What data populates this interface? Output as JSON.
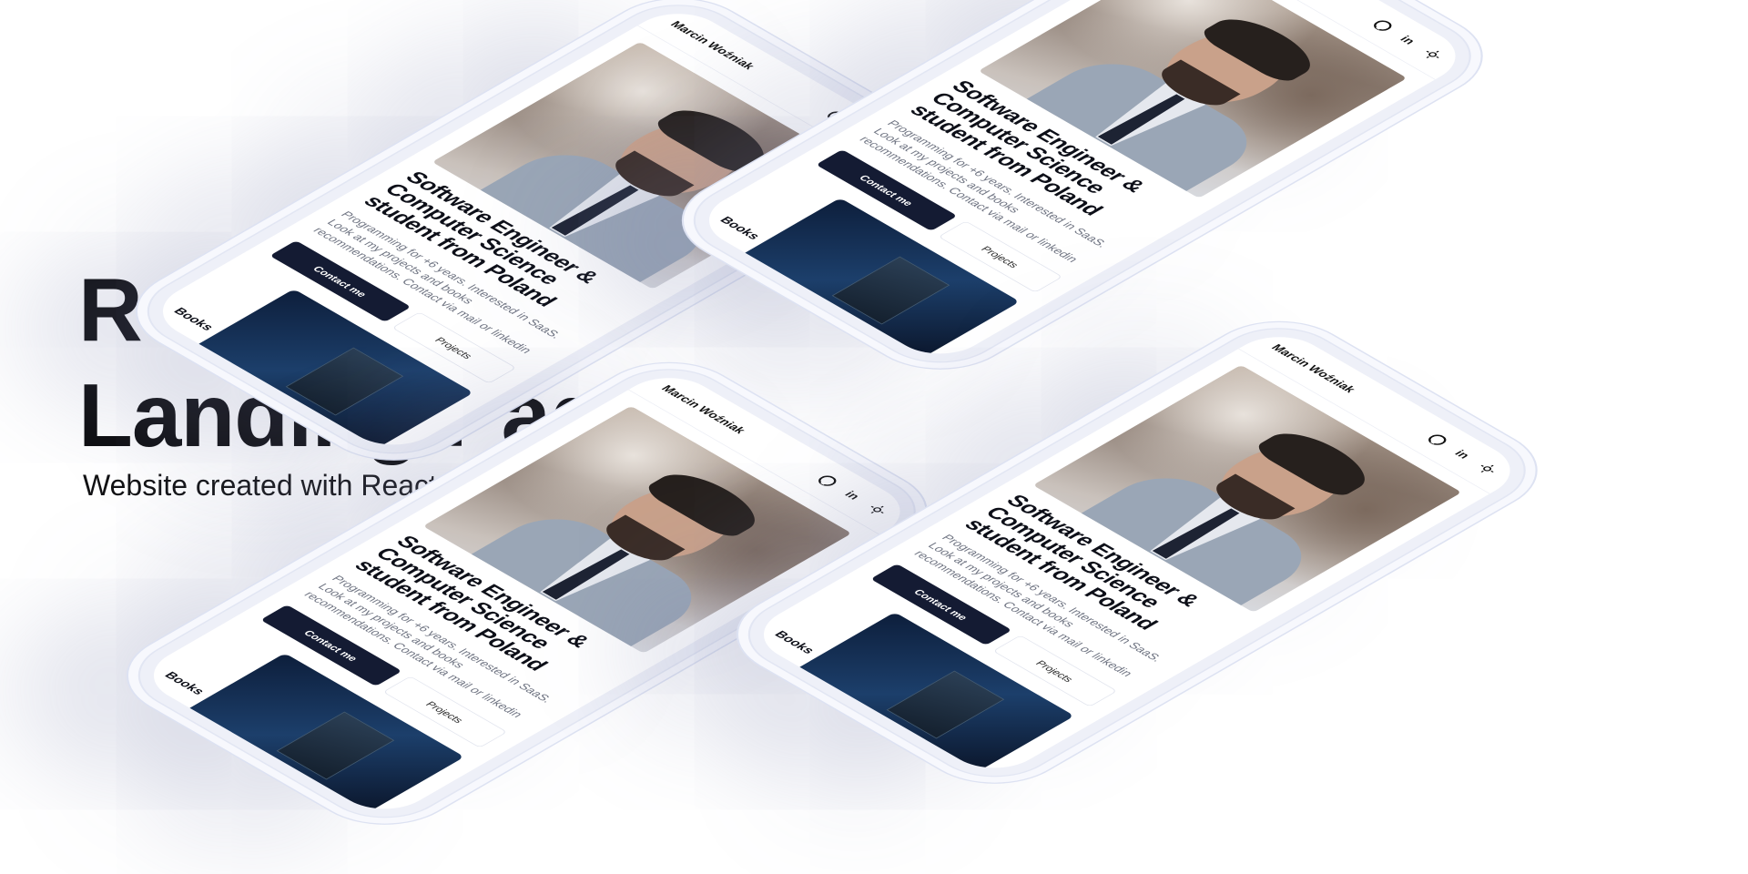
{
  "hero": {
    "title_line1": "React",
    "title_line2": "Landing Page",
    "subtitle": "Website created with React.js"
  },
  "mockup": {
    "brand": "Marcin Woźniak",
    "nav_icons": [
      "github-icon",
      "linkedin-icon",
      "sun-icon"
    ],
    "linkedin_glyph": "in",
    "headline_line1": "Software Engineer &",
    "headline_line2": "Computer Science",
    "headline_line3": "student from Poland",
    "description": "Programming for +6 years. Interested in SaaS. Look at my projects and books recommendations. Contact via mail or linkedin",
    "contact_button": "Contact me",
    "projects_button": "Projects",
    "books_label": "Books"
  },
  "colors": {
    "primary_button": "#141b33",
    "headline": "#0d0f18",
    "muted_text": "#6f7482"
  }
}
